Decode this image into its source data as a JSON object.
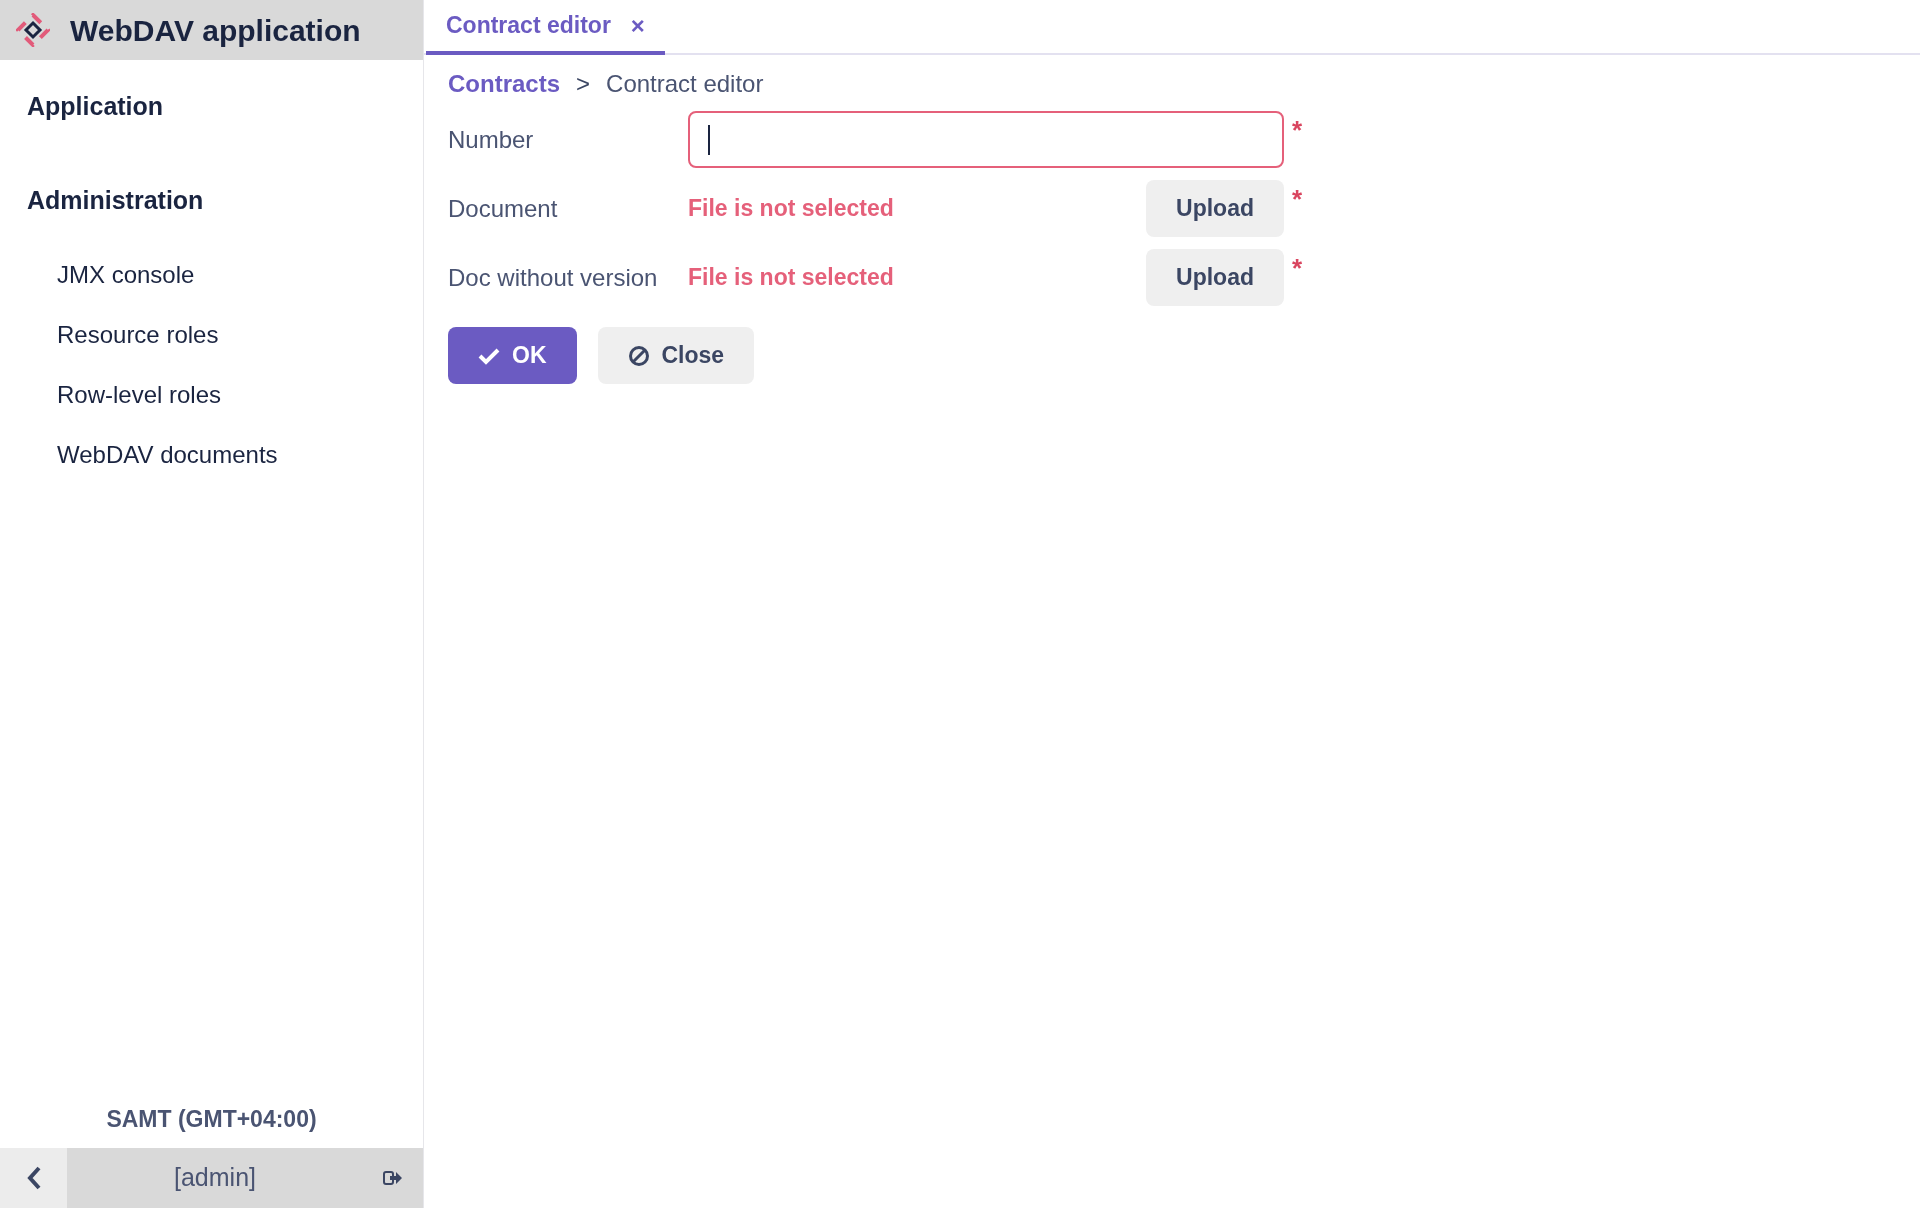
{
  "app": {
    "title": "WebDAV application"
  },
  "menu": [
    {
      "label": "Application"
    },
    {
      "label": "Administration",
      "children": [
        {
          "label": "JMX console"
        },
        {
          "label": "Resource roles"
        },
        {
          "label": "Row-level roles"
        },
        {
          "label": "WebDAV documents"
        }
      ]
    }
  ],
  "timezone": "SAMT (GMT+04:00)",
  "user": "[admin]",
  "tabs": [
    {
      "label": "Contract editor",
      "close": "×",
      "selected": true
    }
  ],
  "breadcrumb": [
    {
      "label": "Contracts",
      "kind": "link"
    },
    {
      "label": "Contract editor",
      "kind": "current"
    }
  ],
  "breadcrumb_separator": ">",
  "form": [
    {
      "label": "Number",
      "kind": "text",
      "required": true,
      "invalid": true,
      "focused": true
    },
    {
      "label": "Document",
      "kind": "file",
      "required": true,
      "status": "File is not selected",
      "button": "Upload"
    },
    {
      "label": "Doc without version",
      "kind": "file",
      "required": true,
      "status": "File is not selected",
      "button": "Upload"
    }
  ],
  "required_mark": "*",
  "buttons": [
    {
      "label": "OK",
      "kind": "primary"
    },
    {
      "label": "Close",
      "kind": "secondary"
    }
  ]
}
